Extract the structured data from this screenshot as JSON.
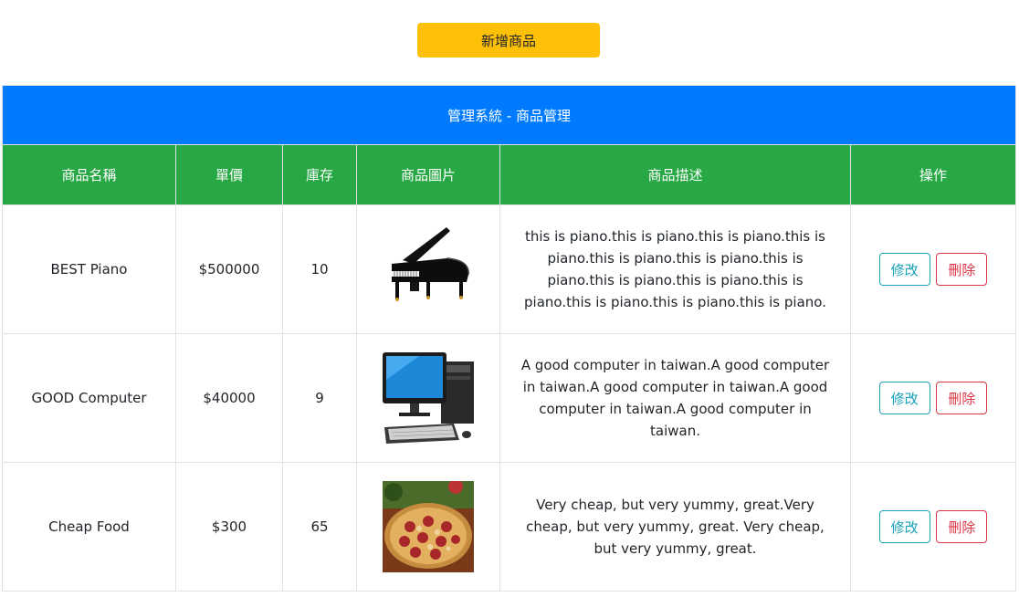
{
  "toolbar": {
    "add_label": "新增商品"
  },
  "table": {
    "title": "管理系統 - 商品管理",
    "headers": [
      "商品名稱",
      "單價",
      "庫存",
      "商品圖片",
      "商品描述",
      "操作"
    ],
    "rows": [
      {
        "name": "BEST Piano",
        "price": "$500000",
        "stock": "10",
        "image": "piano-image",
        "description": "this is piano.this is piano.this is piano.this is piano.this is piano.this is piano.this is piano.this is piano.this is piano.this is piano.this is piano.this is piano.this is piano.",
        "edit_label": "修改",
        "delete_label": "刪除"
      },
      {
        "name": "GOOD Computer",
        "price": "$40000",
        "stock": "9",
        "image": "computer-image",
        "description": "A good computer in taiwan.A good computer in taiwan.A good computer in taiwan.A good computer in taiwan.A good computer in taiwan.",
        "edit_label": "修改",
        "delete_label": "刪除"
      },
      {
        "name": "Cheap Food",
        "price": "$300",
        "stock": "65",
        "image": "pizza-image",
        "description": "Very cheap, but very yummy, great.Very cheap, but very yummy, great. Very cheap, but very yummy, great.",
        "edit_label": "修改",
        "delete_label": "刪除"
      }
    ]
  },
  "colors": {
    "add_button": "#ffc107",
    "title_bar": "#007bff",
    "header_bar": "#28a745",
    "edit_button": "#17a2b8",
    "delete_button": "#dc3545"
  }
}
